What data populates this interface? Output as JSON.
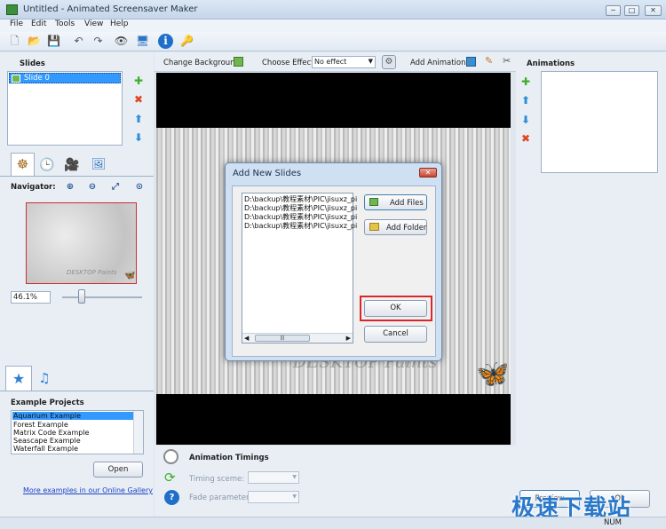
{
  "window": {
    "title": "Untitled - Animated Screensaver Maker",
    "min": "─",
    "max": "□",
    "close": "✕"
  },
  "menu": [
    "File",
    "Edit",
    "Tools",
    "View",
    "Help"
  ],
  "toolbar_icons": [
    "new-file-icon",
    "open-folder-icon",
    "save-icon",
    "undo-icon",
    "redo-icon",
    "eye-preview-icon",
    "monitor-icon",
    "info-icon",
    "key-icon"
  ],
  "slides": {
    "header": "Slides",
    "items": [
      "Slide 0"
    ]
  },
  "navigator": {
    "label": "Navigator:",
    "zoom": "46.1%",
    "logo_text": "DESKTOP Paints"
  },
  "example_projects": {
    "header": "Example Projects",
    "items": [
      "Aquarium Example",
      "Forest Example",
      "Matrix Code Example",
      "Seascape Example",
      "Waterfall Example"
    ],
    "open_label": "Open",
    "gallery_link": "More examples in our Online Gallery"
  },
  "editor_toolbar": {
    "change_background": "Change Background",
    "choose_effect": "Choose Effect:",
    "effect_value": "No effect",
    "add_animation": "Add Animation"
  },
  "animations": {
    "header": "Animations"
  },
  "animation_timings": {
    "header": "Animation Timings",
    "timing_scene": "Timing sceme:",
    "fade_parameter": "Fade parameter:"
  },
  "dialog": {
    "title": "Add New Slides",
    "files": [
      "D:\\backup\\教程素材\\PIC\\jisuxz_pi",
      "D:\\backup\\教程素材\\PIC\\jisuxz_pi",
      "D:\\backup\\教程素材\\PIC\\jisuxz_pi",
      "D:\\backup\\教程素材\\PIC\\jisuxz_pi"
    ],
    "add_files": "Add Files",
    "add_folder": "Add Folder",
    "ok": "OK",
    "cancel": "Cancel",
    "scroll_grip": "|||"
  },
  "preview": {
    "watermark": "DESKTOP Paints"
  },
  "footer": {
    "preview_btn": "Preview",
    "ok_btn": "Ok",
    "status": "NUM",
    "overlay_watermark": "极速下载站"
  },
  "colors": {
    "accent": "#3399ff",
    "highlight": "#d9262b"
  }
}
